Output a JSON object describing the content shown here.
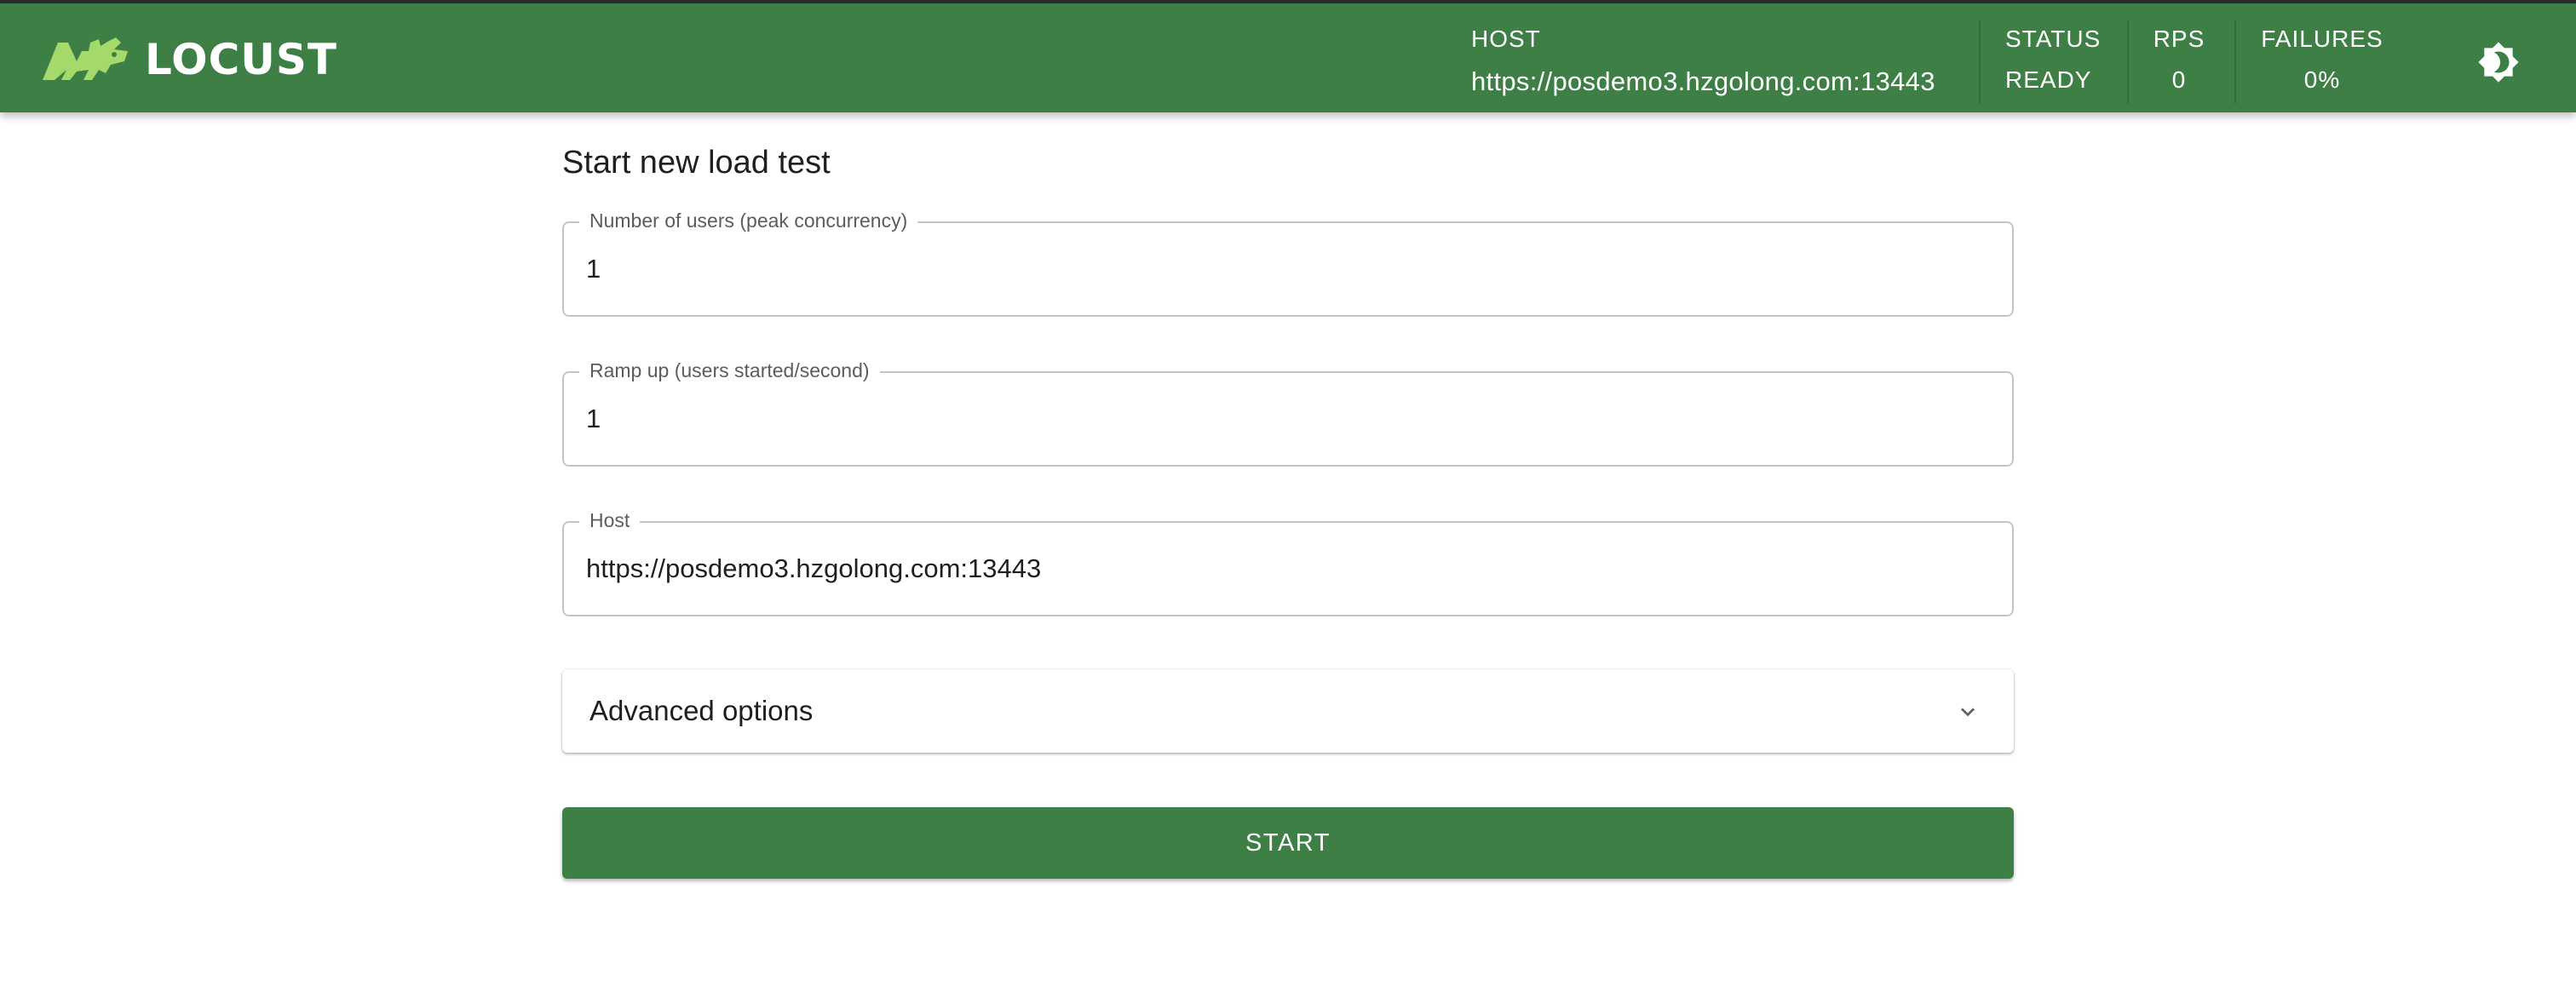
{
  "brand": {
    "name": "LOCUST",
    "logo_icon": "locust-logo",
    "logo_color": "#a5d96a"
  },
  "header": {
    "host_label": "HOST",
    "host_value": "https://posdemo3.hzgolong.com:13443",
    "status_label": "STATUS",
    "status_value": "READY",
    "rps_label": "RPS",
    "rps_value": "0",
    "failures_label": "FAILURES",
    "failures_value": "0%",
    "theme_toggle_icon": "brightness-icon",
    "background_color": "#3d7f45"
  },
  "form": {
    "title": "Start new load test",
    "users": {
      "label": "Number of users (peak concurrency)",
      "value": "1"
    },
    "ramp_up": {
      "label": "Ramp up (users started/second)",
      "value": "1"
    },
    "host": {
      "label": "Host",
      "value": "https://posdemo3.hzgolong.com:13443"
    },
    "advanced": {
      "label": "Advanced options",
      "icon": "chevron-down-icon",
      "expanded": false
    },
    "start_label": "START",
    "accent_color": "#3d7f45"
  }
}
